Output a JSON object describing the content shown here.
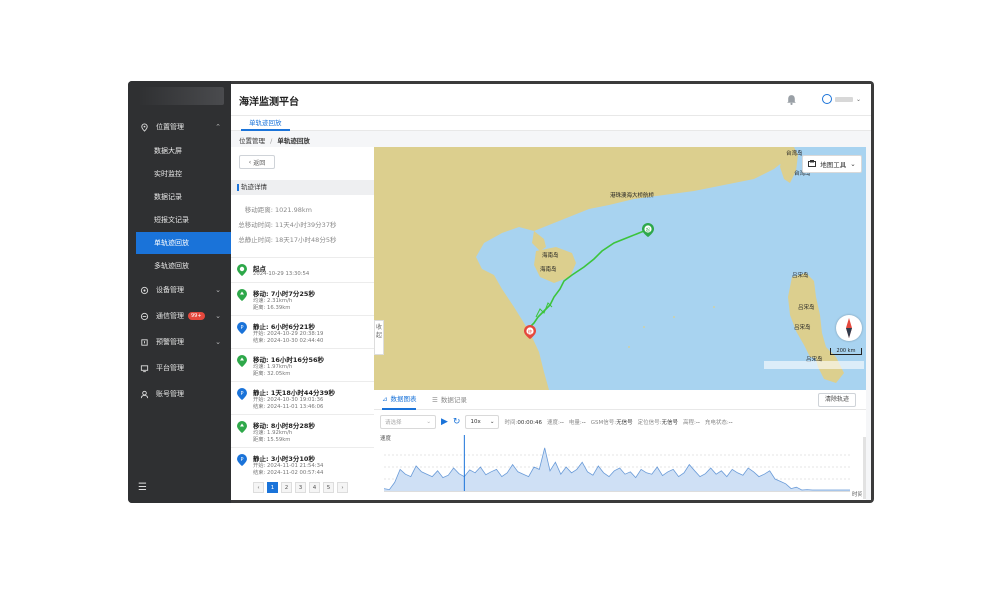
{
  "sidebar": {
    "items": [
      {
        "label": "位置管理",
        "icon": "location-icon",
        "expanded": true
      },
      {
        "label": "设备管理",
        "icon": "device-icon"
      },
      {
        "label": "通信管理",
        "icon": "comm-icon",
        "badge": "99+"
      },
      {
        "label": "预警管理",
        "icon": "alarm-icon"
      },
      {
        "label": "平台管理",
        "icon": "monitor-icon"
      },
      {
        "label": "账号管理",
        "icon": "user-icon"
      }
    ],
    "sub_items": [
      "数据大屏",
      "实时监控",
      "数据记录",
      "短报文记录",
      "单轨迹回放",
      "多轨迹回放"
    ],
    "active_sub": "单轨迹回放"
  },
  "header": {
    "title": "海洋监测平台"
  },
  "tabs": [
    {
      "label": "单轨迹回放"
    }
  ],
  "breadcrumb": {
    "parent": "位置管理",
    "sep": "/",
    "current": "单轨迹回放"
  },
  "left": {
    "back_label": "返回",
    "detail_title": "轨迹详情",
    "stats": [
      {
        "k": "移动距离:",
        "v": "1021.98km"
      },
      {
        "k": "总移动时间:",
        "v": "11天4小时39分37秒"
      },
      {
        "k": "总静止时间:",
        "v": "18天17小时48分5秒"
      }
    ],
    "segments": [
      {
        "type": "start",
        "title": "起点",
        "lines": [
          "2024-10-29 13:30:54"
        ]
      },
      {
        "type": "move",
        "title": "移动: 7小时7分25秒",
        "lines": [
          "均速: 2.31km/h",
          "距离: 16.39km"
        ]
      },
      {
        "type": "stop",
        "title": "静止: 6小时6分21秒",
        "lines": [
          "开始: 2024-10-29 20:38:19",
          "结束: 2024-10-30 02:44:40"
        ]
      },
      {
        "type": "move",
        "title": "移动: 16小时16分56秒",
        "lines": [
          "均速: 1.97km/h",
          "距离: 32.05km"
        ]
      },
      {
        "type": "stop",
        "title": "静止: 1天18小时44分39秒",
        "lines": [
          "开始: 2024-10-30 19:01:36",
          "结束: 2024-11-01 13:46:06"
        ]
      },
      {
        "type": "move",
        "title": "移动: 8小时8分28秒",
        "lines": [
          "均速: 1.92km/h",
          "距离: 15.59km"
        ]
      },
      {
        "type": "stop",
        "title": "静止: 3小时3分10秒",
        "lines": [
          "开始: 2024-11-01 21:54:34",
          "结束: 2024-11-02 00:57:44"
        ]
      }
    ],
    "pager": [
      "‹",
      "1",
      "2",
      "3",
      "4",
      "5",
      "›"
    ]
  },
  "map": {
    "tool_label": "地图工具",
    "collapse_label": "收起",
    "labels": [
      "台湾岛",
      "台湾岛",
      "港珠澳海大桥航桥",
      "海南岛",
      "海南岛",
      "吕宋岛",
      "吕宋岛",
      "吕宋岛",
      "吕宋岛"
    ],
    "start_marker": "起",
    "end_marker": "终",
    "scale": "200 km",
    "colors": {
      "sea": "#a8d3f0",
      "land": "#dccf8e",
      "track": "#3cc43c",
      "accent": "#1a73d9"
    }
  },
  "data_tabs": {
    "chart": "数据图表",
    "records": "数据记录",
    "clear": "清除轨迹"
  },
  "controls": {
    "select_placeholder": "请选择",
    "speed": "10x",
    "time_k": "时间:",
    "time_v": "00:00:46",
    "speed_k": "速度:",
    "speed_v": "--",
    "power_k": "电量:",
    "power_v": "--",
    "gsm_k": "GSM信号:",
    "gsm_v": "无信号",
    "pos_k": "定位信号:",
    "pos_v": "无信号",
    "alt_k": "高程:",
    "alt_v": "--",
    "charge_k": "充电状态:",
    "charge_v": "--"
  },
  "chart_data": {
    "type": "area",
    "ylabel": "速度",
    "xlabel": "时间",
    "values": [
      0.05,
      0.03,
      0.18,
      0.45,
      0.35,
      0.3,
      0.52,
      0.4,
      0.35,
      0.3,
      0.42,
      0.28,
      0.33,
      0.48,
      0.36,
      0.3,
      0.44,
      0.38,
      0.5,
      0.34,
      0.4,
      0.45,
      0.3,
      0.38,
      0.55,
      0.4,
      0.35,
      0.3,
      0.5,
      0.45,
      0.9,
      0.42,
      0.6,
      0.35,
      0.5,
      0.38,
      0.45,
      0.6,
      0.4,
      0.33,
      0.52,
      0.38,
      0.3,
      0.42,
      0.48,
      0.35,
      0.4,
      0.28,
      0.45,
      0.38,
      0.35,
      0.5,
      0.32,
      0.4,
      0.45,
      0.3,
      0.38,
      0.55,
      0.42,
      0.3,
      0.36,
      0.48,
      0.35,
      0.42,
      0.3,
      0.45,
      0.38,
      0.33,
      0.48,
      0.4,
      0.3,
      0.35,
      0.42,
      0.25,
      0.2,
      0.15,
      0.05,
      0.08,
      0.02,
      0.03,
      0.02,
      0.02,
      0.02,
      0.02,
      0.02,
      0.02,
      0.02,
      0.02
    ],
    "cursor_index": 15,
    "ylim": [
      0,
      1
    ]
  }
}
